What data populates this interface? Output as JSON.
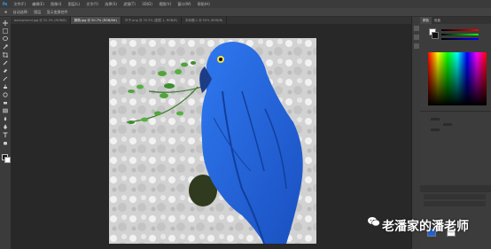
{
  "app": {
    "logo": "Ps"
  },
  "menu": [
    "文件(F)",
    "编辑(E)",
    "图像(I)",
    "图层(L)",
    "文字(Y)",
    "选择(S)",
    "滤镜(T)",
    "3D(D)",
    "视图(V)",
    "窗口(W)",
    "帮助(H)"
  ],
  "options": [
    "自动选择:",
    "图层",
    "显示变换控件"
  ],
  "tabs": [
    {
      "label": "background.jpg @ 52.3% (RGB/8)",
      "active": false
    },
    {
      "label": "鹦鹉.jpg @ 50.7% (RGB/8#)",
      "active": true
    },
    {
      "label": "叶子.png @ 33.3% (图层 1, RGB/8)",
      "active": false
    },
    {
      "label": "未标题-1 @ 50% (RGB/8)",
      "active": false
    }
  ],
  "panel_tabs": [
    "颜色",
    "色板"
  ],
  "watermark": {
    "text": "老潘家的潘老师",
    "icon": "wechat-icon"
  },
  "colors": {
    "parrot": "#1f63d6",
    "canvas_bg": "#282828",
    "accent": "#31a8ff"
  }
}
